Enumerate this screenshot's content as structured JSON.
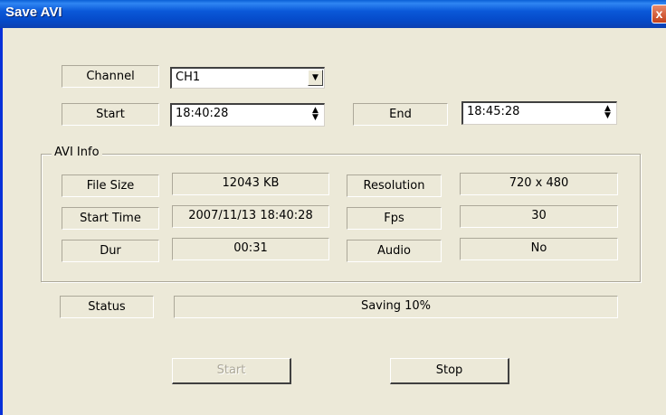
{
  "window": {
    "title": "Save AVI",
    "close_label": "x"
  },
  "channel": {
    "label": "Channel",
    "value": "CH1"
  },
  "start": {
    "label": "Start",
    "value": "18:40:28"
  },
  "end": {
    "label": "End",
    "value": "18:45:28"
  },
  "avi_info": {
    "title": "AVI Info",
    "file_size": {
      "label": "File Size",
      "value": "12043 KB"
    },
    "start_time": {
      "label": "Start Time",
      "value": "2007/11/13 18:40:28"
    },
    "dur": {
      "label": "Dur",
      "value": "00:31"
    },
    "resolution": {
      "label": "Resolution",
      "value": "720 x 480"
    },
    "fps": {
      "label": "Fps",
      "value": "30"
    },
    "audio": {
      "label": "Audio",
      "value": "No"
    }
  },
  "status": {
    "label": "Status",
    "value": "Saving 10%",
    "progress_percent": 10
  },
  "buttons": {
    "start": "Start",
    "stop": "Stop"
  }
}
